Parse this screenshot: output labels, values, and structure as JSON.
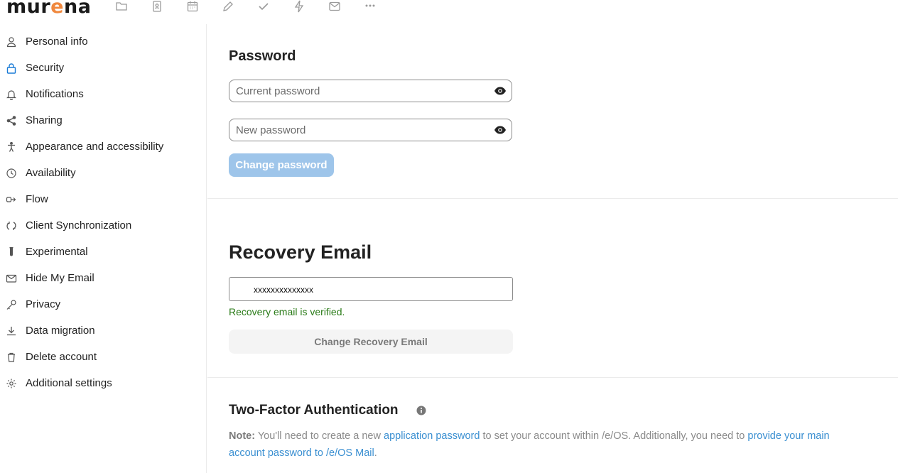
{
  "brand": {
    "logo_prefix": "mur",
    "logo_accent": "e",
    "logo_suffix": "na",
    "accent_color": "#f0883e"
  },
  "topbar": {
    "apps": [
      "folder-icon",
      "contacts-icon",
      "calendar-icon",
      "notes-icon",
      "tasks-icon",
      "activity-icon",
      "mail-icon",
      "more-icon"
    ]
  },
  "sidebar": {
    "items": [
      {
        "label": "Personal info",
        "icon": "user-icon"
      },
      {
        "label": "Security",
        "icon": "lock-icon",
        "active": true
      },
      {
        "label": "Notifications",
        "icon": "bell-icon"
      },
      {
        "label": "Sharing",
        "icon": "share-icon"
      },
      {
        "label": "Appearance and accessibility",
        "icon": "accessibility-icon"
      },
      {
        "label": "Availability",
        "icon": "clock-icon"
      },
      {
        "label": "Flow",
        "icon": "flow-icon"
      },
      {
        "label": "Client Synchronization",
        "icon": "sync-icon"
      },
      {
        "label": "Experimental",
        "icon": "flask-icon"
      },
      {
        "label": "Hide My Email",
        "icon": "mail-icon"
      },
      {
        "label": "Privacy",
        "icon": "key-icon"
      },
      {
        "label": "Data migration",
        "icon": "download-icon"
      },
      {
        "label": "Delete account",
        "icon": "trash-icon"
      },
      {
        "label": "Additional settings",
        "icon": "gear-icon"
      }
    ]
  },
  "password": {
    "title": "Password",
    "current_placeholder": "Current password",
    "new_placeholder": "New password",
    "button": "Change password"
  },
  "recovery": {
    "title": "Recovery Email",
    "value": "xxxxxxxxxxxxxx",
    "status": "Recovery email is verified.",
    "button": "Change Recovery Email"
  },
  "twofa": {
    "title": "Two-Factor Authentication",
    "note_label": "Note:",
    "note_text_1": " You'll need to create a new ",
    "link_1": "application password",
    "note_text_2": " to set your account within /e/OS. Additionally, you need to ",
    "link_2": "provide your main account password to /e/OS Mail",
    "note_text_3": "."
  }
}
